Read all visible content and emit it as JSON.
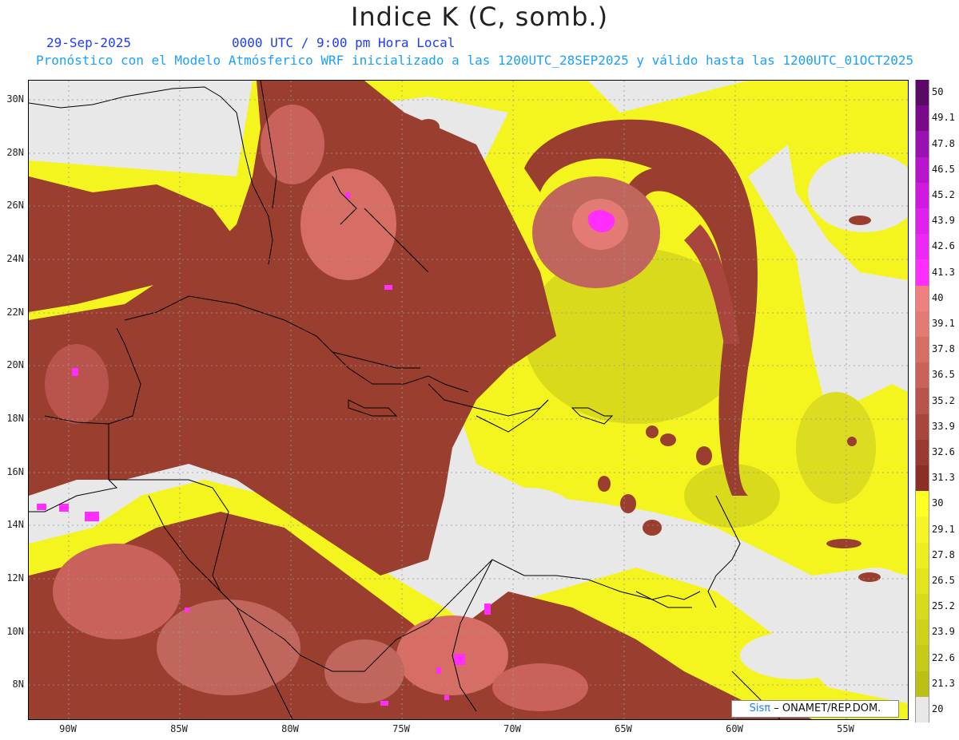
{
  "title": "Indice K (C, somb.)",
  "date": "29-Sep-2025",
  "time": "0000 UTC / 9:00 pm Hora Local",
  "forecast_note": "Pronóstico con el Modelo Atmósferico WRF inicializado a las 1200UTC_28SEP2025 y válido hasta las  1200UTC_01OCT2025",
  "lat_labels": [
    "30N",
    "28N",
    "26N",
    "24N",
    "22N",
    "20N",
    "18N",
    "16N",
    "14N",
    "12N",
    "10N",
    "8N"
  ],
  "lon_labels": [
    "90W",
    "85W",
    "80W",
    "75W",
    "70W",
    "65W",
    "60W",
    "55W"
  ],
  "colorbar": {
    "labels": [
      "50",
      "49.1",
      "47.8",
      "46.5",
      "45.2",
      "43.9",
      "42.6",
      "41.3",
      "40",
      "39.1",
      "37.8",
      "36.5",
      "35.2",
      "33.9",
      "32.6",
      "31.3",
      "30",
      "29.1",
      "27.8",
      "26.5",
      "25.2",
      "23.9",
      "22.6",
      "21.3",
      "20"
    ],
    "colors": [
      "#5a0a66",
      "#7a0a8a",
      "#9a10b0",
      "#b814cc",
      "#d01ae0",
      "#e020ec",
      "#ee28f4",
      "#ff2eff",
      "#f08080",
      "#e47a74",
      "#d66e66",
      "#c9625a",
      "#b9544c",
      "#a8463e",
      "#983a32",
      "#8a2e26",
      "#ffff26",
      "#f4f426",
      "#ecee22",
      "#e2e41e",
      "#d8da1c",
      "#cfd21a",
      "#c6ca18",
      "#bcc016",
      "#e8e8e8"
    ]
  },
  "colors": {
    "background": "#e8e8e8",
    "yellow": "#f4f41e",
    "olive": "#d2d21c",
    "brown": "#9a3e30",
    "light_brown": "#c0665c",
    "pink": "#e47a74",
    "magenta": "#ff2eff"
  },
  "credit": {
    "brand": "Sisπ",
    "text": "– ONAMET/REP.DOM."
  }
}
